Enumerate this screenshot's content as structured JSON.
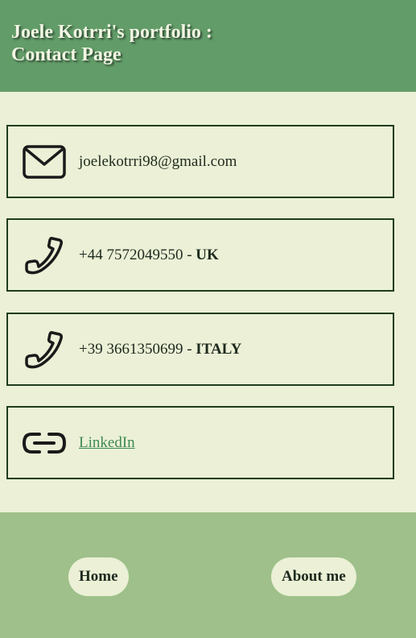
{
  "header": {
    "title": "Joele Kotrri's portfolio : Contact Page"
  },
  "contacts": {
    "email": {
      "icon": "envelope-icon",
      "text": "joelekotrri98@gmail.com"
    },
    "phone_uk": {
      "icon": "phone-icon",
      "number": "+44 7572049550 - ",
      "country": "UK"
    },
    "phone_it": {
      "icon": "phone-icon",
      "number": "+39 3661350699 - ",
      "country": "ITALY"
    },
    "linkedin": {
      "icon": "link-icon",
      "label": "LinkedIn"
    }
  },
  "footer": {
    "home_label": "Home",
    "about_label": "About me"
  },
  "colors": {
    "header_bg": "#629c69",
    "main_bg": "#ebf0d6",
    "footer_bg": "#9fc08a",
    "card_border": "#1f3d1f",
    "link": "#3f8a52"
  }
}
